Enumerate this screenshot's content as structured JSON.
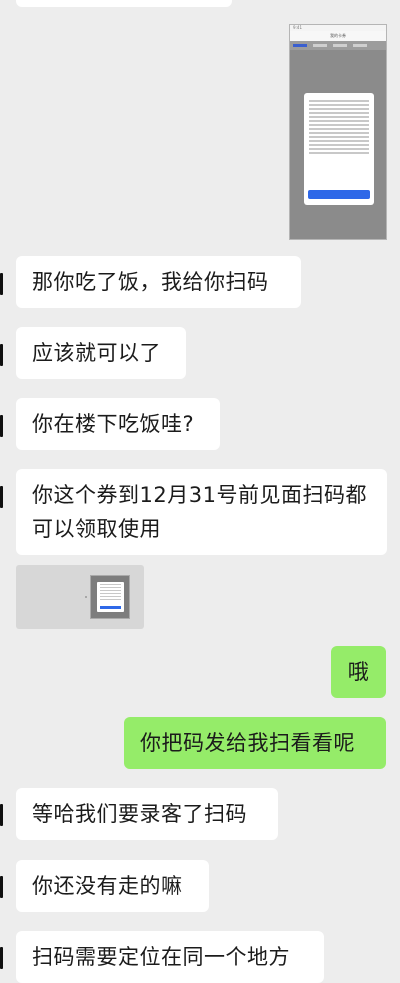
{
  "colors": {
    "background": "#ededed",
    "incoming_bubble": "#ffffff",
    "outgoing_bubble": "#95ec69"
  },
  "screenshot_big": {
    "status_text": "9:41",
    "header_title": "我的卡券"
  },
  "messages": [
    {
      "direction": "in",
      "text": "那你吃了饭，我给你扫码"
    },
    {
      "direction": "in",
      "text": "应该就可以了"
    },
    {
      "direction": "in",
      "text": "你在楼下吃饭哇?"
    },
    {
      "direction": "in",
      "text": "你这个券到12月31号前见面扫码都可以领取使用"
    },
    {
      "direction": "out",
      "text": "哦"
    },
    {
      "direction": "out",
      "text": "你把码发给我扫看看呢"
    },
    {
      "direction": "in",
      "text": "等哈我们要录客了扫码"
    },
    {
      "direction": "in",
      "text": "你还没有走的嘛"
    },
    {
      "direction": "in",
      "text": "扫码需要定位在同一个地方"
    }
  ]
}
